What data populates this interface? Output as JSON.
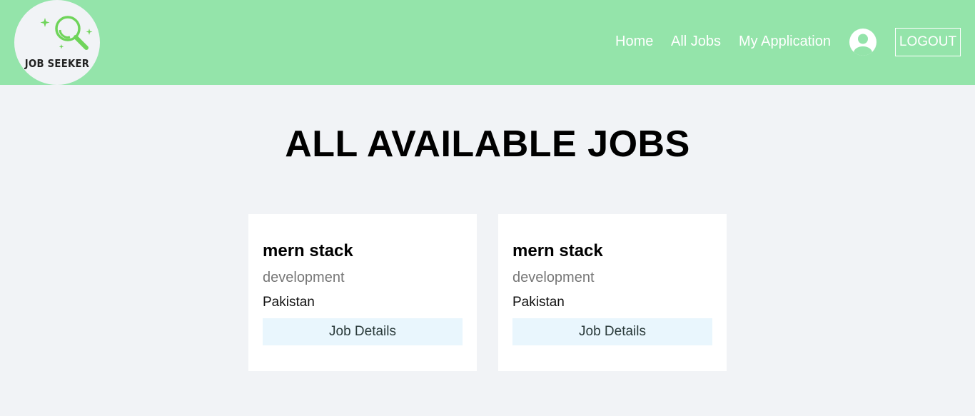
{
  "brand": {
    "logo_text": "JOB SEEKER",
    "accent_color": "#94e4aa",
    "icon": "magnifier-icon"
  },
  "nav": {
    "links": [
      "Home",
      "All Jobs",
      "My Application"
    ],
    "profile_icon": "user-circle-icon",
    "logout_label": "LOGOUT"
  },
  "page": {
    "title": "ALL AVAILABLE JOBS"
  },
  "jobs": [
    {
      "title": "mern stack",
      "category": "development",
      "country": "Pakistan",
      "details_label": "Job Details"
    },
    {
      "title": "mern stack",
      "category": "development",
      "country": "Pakistan",
      "details_label": "Job Details"
    }
  ]
}
